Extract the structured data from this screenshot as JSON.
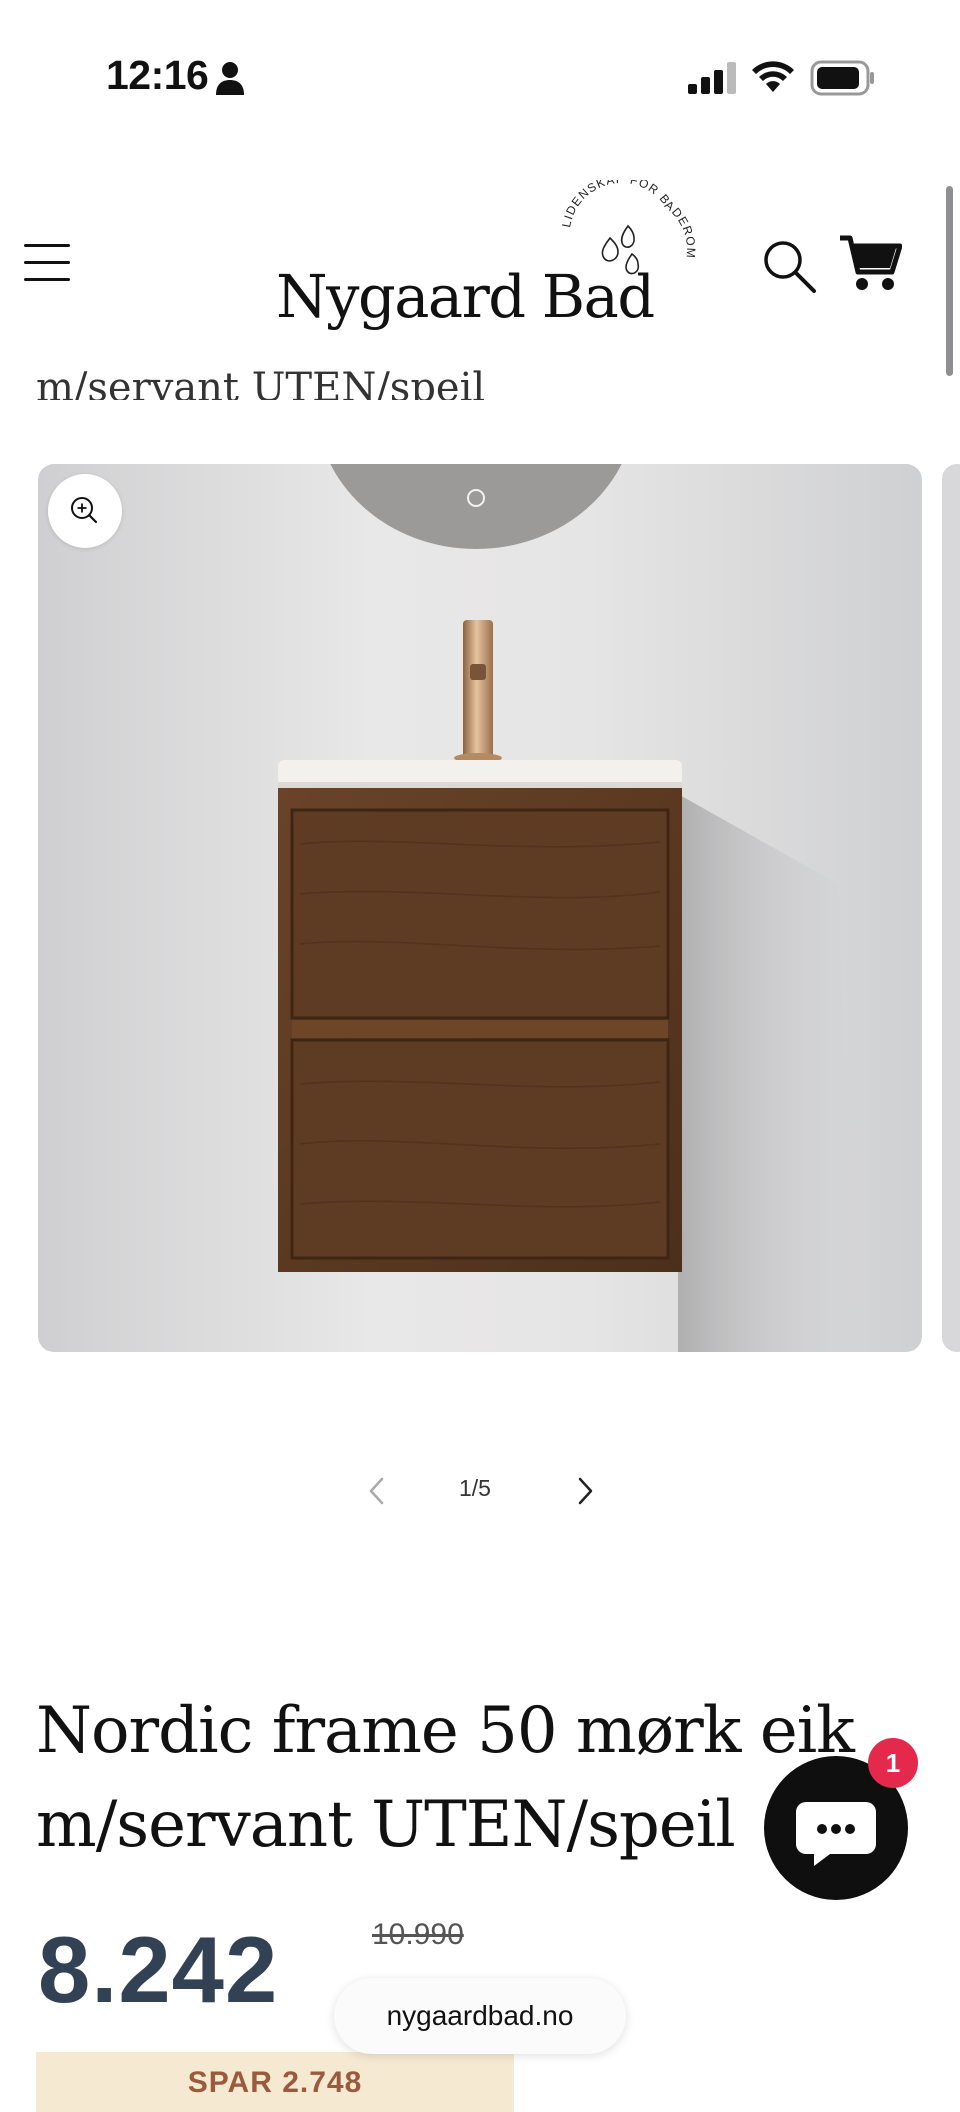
{
  "status_bar": {
    "time": "12:16",
    "icons": [
      "person-icon",
      "signal-icon",
      "wifi-icon",
      "battery-icon"
    ]
  },
  "header": {
    "menu_icon": "hamburger-menu-icon",
    "logo_text": "Nygaard Bad",
    "logo_tagline": "LIDENSKAP FOR BADEROM",
    "search_icon": "search-icon",
    "cart_icon": "cart-icon"
  },
  "partial_title": "m/servant UTEN/speil",
  "gallery": {
    "zoom_icon": "zoom-in-icon",
    "counter": "1/5",
    "prev_icon": "chevron-left-icon",
    "next_icon": "chevron-right-icon"
  },
  "product": {
    "title": "Nordic frame 50 mørk eik m/servant UTEN/speil",
    "price": "8.242",
    "old_price": "10.990",
    "save_label": "SPAR 2.748"
  },
  "chat": {
    "icon": "chat-bubble-icon",
    "badge_count": "1"
  },
  "browser": {
    "url": "nygaardbad.no"
  },
  "colors": {
    "price": "#334155",
    "save_badge_bg": "#f6e9d2",
    "save_badge_text": "#9a5a3c",
    "chat_badge": "#e5294d",
    "cabinet_wood": "#5c3a24",
    "faucet_gold": "#c9976a"
  }
}
